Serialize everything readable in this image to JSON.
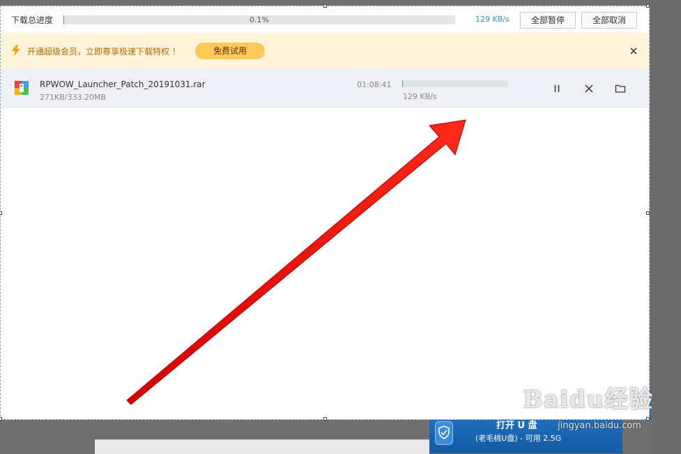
{
  "header": {
    "label": "下载总进度",
    "progress_text": "0.1%",
    "progress_fraction": 0.001,
    "speed": "129 KB/s",
    "pause_all_label": "全部暂停",
    "cancel_all_label": "全部取消"
  },
  "vip": {
    "message": "开通超级会员，立即尊享极速下载特权 ！",
    "trial_label": "免费试用"
  },
  "download": {
    "file_name": "RPWOW_Launcher_Patch_20191031.rar",
    "size": "271KB/333.20MB",
    "time_left": "01:08:41",
    "speed": "129 KB/s",
    "progress_fraction": 0.001
  },
  "icons": [
    "lightning-icon",
    "close-icon",
    "archive-file-icon",
    "pause-icon",
    "cancel-icon",
    "folder-icon",
    "shield-icon"
  ],
  "background": {
    "toast_title": "打开 U 盘",
    "toast_subtitle": "(老毛桃U盘) - 可用 2.5G",
    "watermark_logo": "Baidu经验",
    "watermark_url": "jingyan.baidu.com"
  },
  "colors": {
    "accent": "#3c9be8",
    "vip_background": "#fff4d9",
    "vip_button": "#ffc95a",
    "arrow": "#e8110b"
  }
}
